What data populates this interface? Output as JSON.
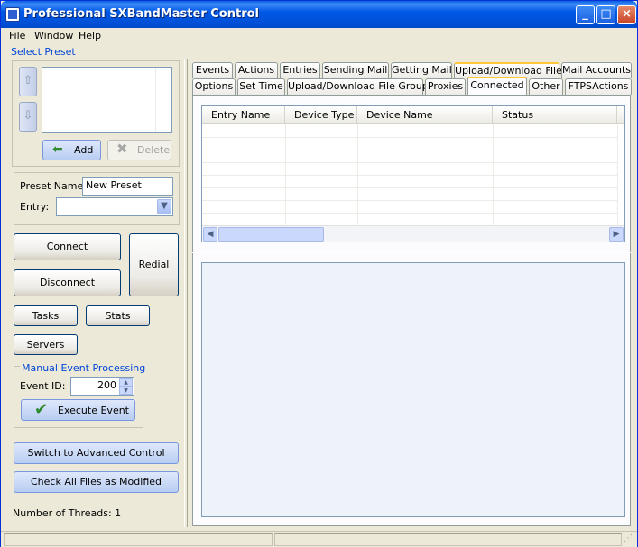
{
  "window": {
    "title": "Professional SXBandMaster Control"
  },
  "menu": [
    "File",
    "Window",
    "Help"
  ],
  "preset": {
    "group_title": "Select Preset",
    "add_label": "Add",
    "delete_label": "Delete",
    "name_label": "Preset Name:",
    "name_value": "New Preset",
    "entry_label": "Entry:",
    "entry_value": ""
  },
  "actions": {
    "connect": "Connect",
    "disconnect": "Disconnect",
    "redial": "Redial",
    "tasks": "Tasks",
    "stats": "Stats",
    "servers": "Servers"
  },
  "manual": {
    "title": "Manual Event Processing",
    "event_id_label": "Event ID:",
    "event_id_value": "200",
    "execute_label": "Execute Event"
  },
  "bottom": {
    "switch_label": "Switch to Advanced Control",
    "check_label": "Check All Files as Modified",
    "threads_label": "Number of Threads: 1"
  },
  "tabs": {
    "row1": [
      "Events",
      "Actions",
      "Entries",
      "Sending Mail",
      "Getting Mail",
      "Upload/Download File",
      "Mail Accounts"
    ],
    "row2": [
      "Options",
      "Set Time",
      "Upload/Download File Group",
      "Proxies",
      "Connected",
      "Other",
      "FTPSActions"
    ]
  },
  "grid": {
    "columns": [
      "Entry Name",
      "Device Type",
      "Device Name",
      "Status"
    ]
  },
  "colors": {
    "title_bar": "#0058e6",
    "accent": "#0046d5",
    "tab_highlight": "#ffc83c"
  }
}
